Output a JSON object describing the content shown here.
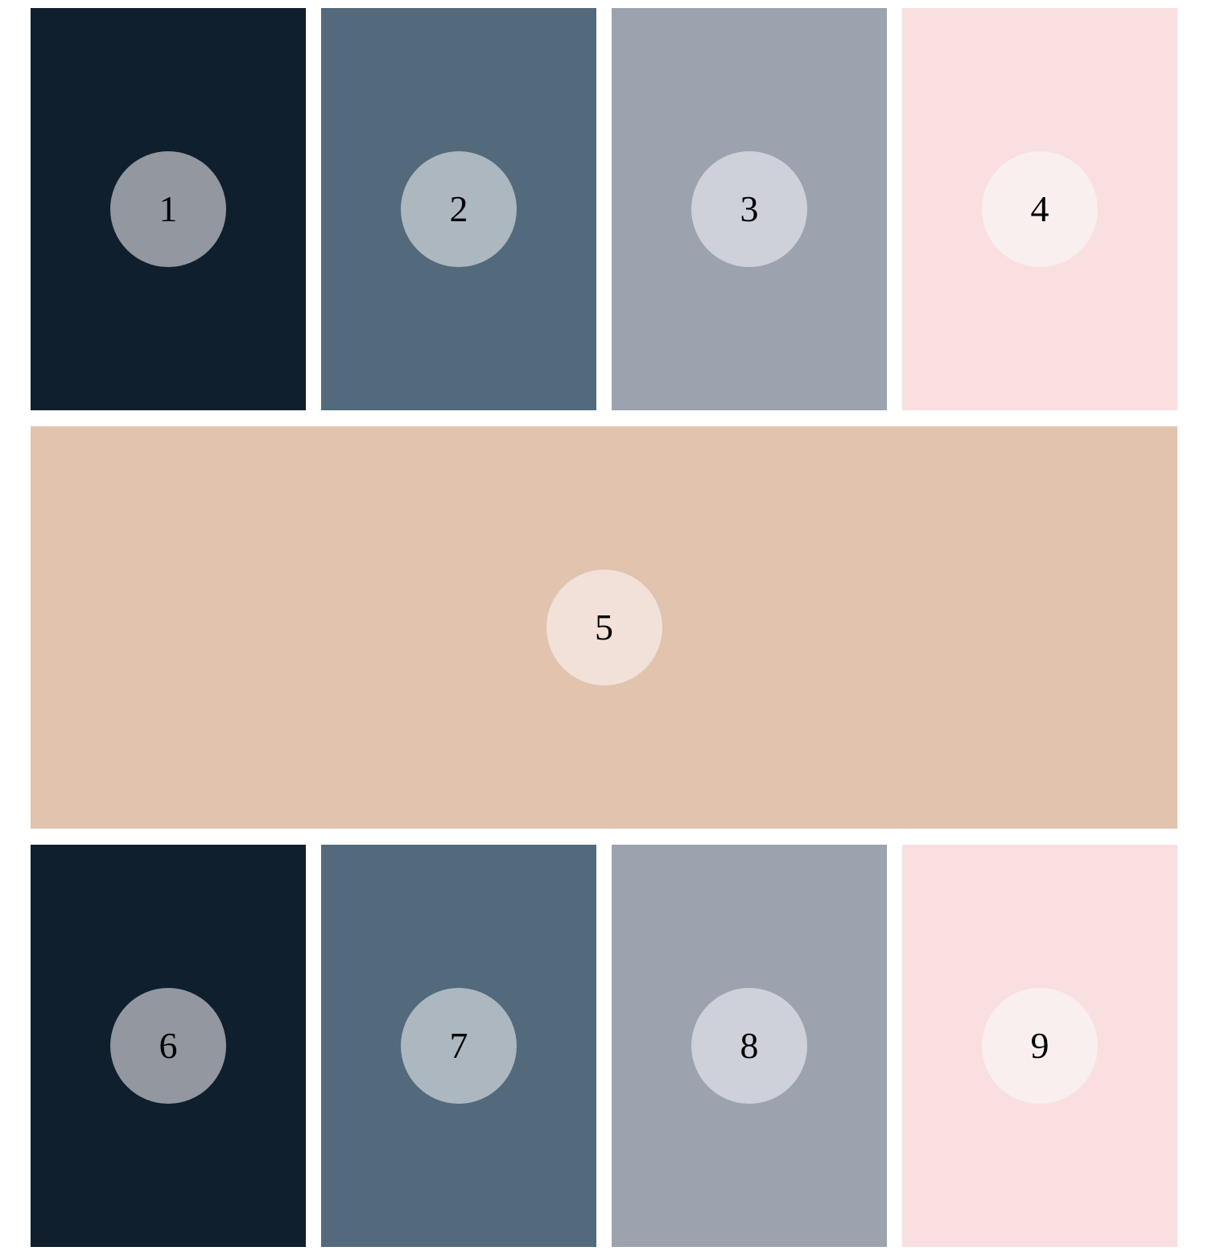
{
  "tiles": [
    {
      "label": "1",
      "bg": "#0f1f2d",
      "circle": "#93979f"
    },
    {
      "label": "2",
      "bg": "#526a7b",
      "circle": "#adb7c0"
    },
    {
      "label": "3",
      "bg": "#9ca3af",
      "circle": "#ced1d9"
    },
    {
      "label": "4",
      "bg": "#f9dfe0",
      "circle": "#f9efee"
    },
    {
      "label": "5",
      "bg": "#e1c3ae",
      "circle": "#f1e1d8"
    },
    {
      "label": "6",
      "bg": "#0f1f2d",
      "circle": "#93979f"
    },
    {
      "label": "7",
      "bg": "#526a7b",
      "circle": "#adb7c0"
    },
    {
      "label": "8",
      "bg": "#9ca3af",
      "circle": "#ced1d9"
    },
    {
      "label": "9",
      "bg": "#f9dfe0",
      "circle": "#f9efee"
    }
  ]
}
